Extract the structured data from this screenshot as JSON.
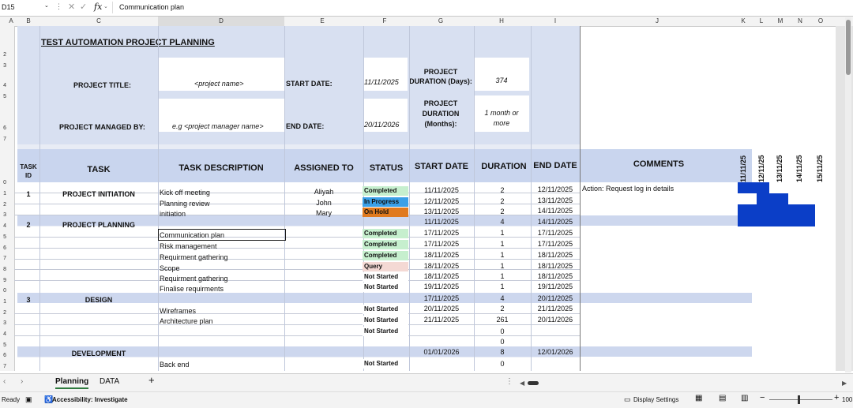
{
  "formula_bar": {
    "name_box": "D15",
    "formula": "Communication plan"
  },
  "columns": [
    "A",
    "B",
    "C",
    "D",
    "E",
    "F",
    "G",
    "H",
    "I",
    "J",
    "K",
    "L",
    "M",
    "N",
    "O"
  ],
  "row_numbers": [
    "2",
    "3",
    "4",
    "5",
    "6",
    "7",
    "0",
    "1",
    "2",
    "3",
    "4",
    "5",
    "6",
    "7",
    "8",
    "9",
    "0",
    "1",
    "2",
    "3",
    "4",
    "5",
    "6",
    "7"
  ],
  "header": {
    "title": "TEST AUTOMATION  PROJECT PLANNING",
    "project_title_label": "PROJECT TITLE:",
    "project_title_value": "<project name>",
    "start_date_label": "START DATE:",
    "start_date_value": "11/11/2025",
    "duration_days_label_1": "PROJECT",
    "duration_days_label_2": "DURATION (Days):",
    "duration_days_value": "374",
    "managed_by_label": "PROJECT MANAGED BY:",
    "managed_by_value": "e.g <project manager name>",
    "end_date_label": "END DATE:",
    "end_date_value": "20/11/2026",
    "duration_months_label_1": "PROJECT",
    "duration_months_label_2": "DURATION",
    "duration_months_label_3": "(Months):",
    "duration_months_value_1": "1 month or",
    "duration_months_value_2": "more"
  },
  "table_headers": {
    "task_id_1": "TASK",
    "task_id_2": "ID",
    "task": "TASK",
    "description": "TASK DESCRIPTION",
    "assigned": "ASSIGNED TO",
    "status": "STATUS",
    "start": "START DATE",
    "duration": "DURATION",
    "end": "END DATE",
    "comments": "COMMENTS"
  },
  "gantt_dates": [
    "11/11/25",
    "12/11/25",
    "13/11/25",
    "14/11/25",
    "15/11/25"
  ],
  "rows": {
    "r1": {
      "id": "1",
      "task": "PROJECT INITIATION",
      "desc": "Kick off meeting",
      "assigned": "Aliyah",
      "status": "Completed",
      "start": "11/11/2025",
      "dur": "2",
      "end": "12/11/2025",
      "comment": "Action: Request log in details"
    },
    "r2": {
      "desc": "Planning review",
      "assigned": "John",
      "status": "In Progress",
      "start": "12/11/2025",
      "dur": "2",
      "end": "13/11/2025"
    },
    "r3": {
      "desc": "initiation",
      "assigned": "Mary",
      "status": "On Hold",
      "start": "13/11/2025",
      "dur": "2",
      "end": "14/11/2025"
    },
    "s2": {
      "id": "2",
      "task": "PROJECT PLANNING",
      "start": "11/11/2025",
      "dur": "4",
      "end": "14/11/2025"
    },
    "r5": {
      "desc": "Communication plan",
      "status": "Completed",
      "start": "17/11/2025",
      "dur": "1",
      "end": "17/11/2025"
    },
    "r6": {
      "desc": "Risk management",
      "status": "Completed",
      "start": "17/11/2025",
      "dur": "1",
      "end": "17/11/2025"
    },
    "r7": {
      "desc": "Requirment gathering",
      "status": "Completed",
      "start": "18/11/2025",
      "dur": "1",
      "end": "18/11/2025"
    },
    "r8": {
      "desc": "Scope",
      "status": "Query",
      "start": "18/11/2025",
      "dur": "1",
      "end": "18/11/2025"
    },
    "r9": {
      "desc": "Requirment gathering",
      "status": "Not Started",
      "start": "18/11/2025",
      "dur": "1",
      "end": "18/11/2025"
    },
    "r10": {
      "desc": "Finalise requirments",
      "status": "Not Started",
      "start": "19/11/2025",
      "dur": "1",
      "end": "19/11/2025"
    },
    "s3": {
      "id": "3",
      "task": "DESIGN",
      "start": "17/11/2025",
      "dur": "4",
      "end": "20/11/2025"
    },
    "r12": {
      "desc": "Wireframes",
      "status": "Not Started",
      "start": "20/11/2025",
      "dur": "2",
      "end": "21/11/2025"
    },
    "r13": {
      "desc": "Architecture plan",
      "status": "Not Started",
      "start": "21/11/2025",
      "dur": "261",
      "end": "20/11/2026"
    },
    "r14": {
      "status": "Not Started",
      "dur": "0"
    },
    "r15": {
      "dur": "0"
    },
    "s4": {
      "task": "DEVELOPMENT",
      "start": "01/01/2026",
      "dur": "8",
      "end": "12/01/2026"
    },
    "r17": {
      "desc": "Back end",
      "status": "Not Started",
      "dur": "0"
    }
  },
  "status_colors": {
    "Completed": "#c6efce",
    "In Progress": "#3aa0e8",
    "On Hold": "#e07a1f",
    "Query": "#f4d9d4",
    "Not Started": "#ffffff"
  },
  "gantt_fill": "#0b3ec7",
  "sheet_tabs": [
    "Planning",
    "DATA"
  ],
  "active_tab": "Planning",
  "status_bar": {
    "ready": "Ready",
    "accessibility": "Accessibility: Investigate",
    "display_settings": "Display Settings",
    "zoom": "100"
  }
}
